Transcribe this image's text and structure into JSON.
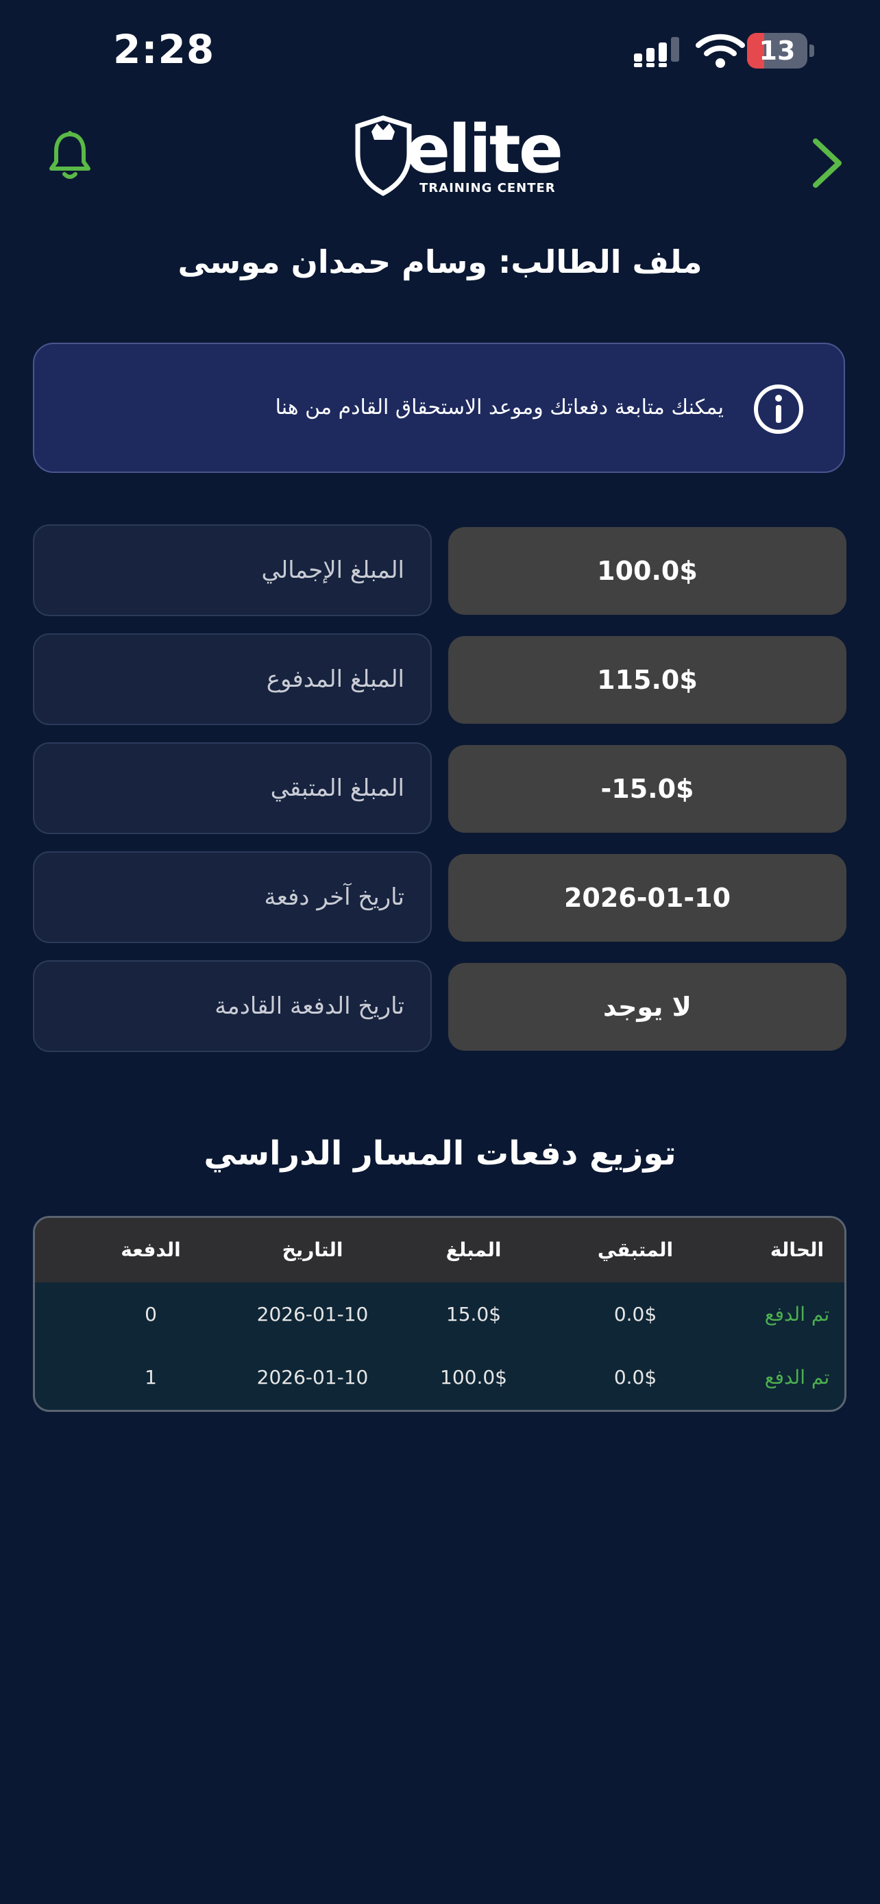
{
  "status_bar": {
    "time": "2:28",
    "battery": "13",
    "battery_level": 0.13
  },
  "header": {
    "logo_text": "elite",
    "logo_subtitle": "TRAINING CENTER"
  },
  "page": {
    "title": "ملف الطالب: وسام حمدان موسى"
  },
  "banner": {
    "text": "يمكنك متابعة دفعاتك وموعد الاستحقاق القادم من هنا",
    "icon": "info-icon"
  },
  "summary": [
    {
      "label": "المبلغ الإجمالي",
      "value": "100.0$"
    },
    {
      "label": "المبلغ المدفوع",
      "value": "115.0$"
    },
    {
      "label": "المبلغ المتبقي",
      "value": "-15.0$"
    },
    {
      "label": "تاريخ آخر دفعة",
      "value": "2026-01-10"
    },
    {
      "label": "تاريخ الدفعة القادمة",
      "value": "لا يوجد"
    }
  ],
  "payments": {
    "title": "توزيع دفعات المسار الدراسي",
    "columns": [
      "الدفعة",
      "التاريخ",
      "المبلغ",
      "المتبقي",
      "الحالة"
    ],
    "rows": [
      [
        "0",
        "2026-01-10",
        "15.0$",
        "0.0$",
        "تم الدفع"
      ],
      [
        "1",
        "2026-01-10",
        "100.0$",
        "0.0$",
        "تم الدفع"
      ]
    ]
  },
  "colors": {
    "background": "#0b1833",
    "accent": "#5ab947",
    "banner": "#1e2a5e",
    "paid": "#4caf50"
  }
}
